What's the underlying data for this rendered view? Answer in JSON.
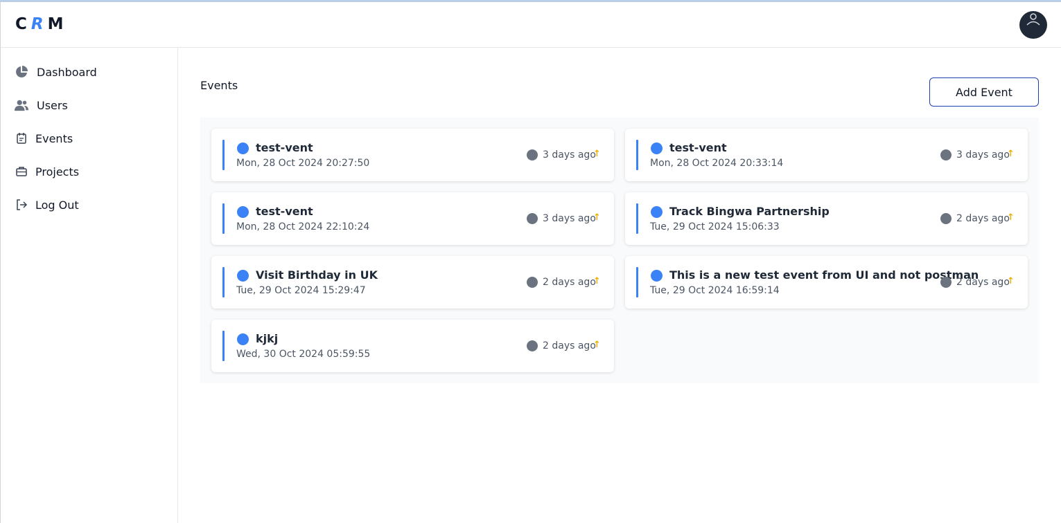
{
  "app": {
    "logo": {
      "c": "C",
      "r": "R",
      "m": "M"
    }
  },
  "sidebar": {
    "items": [
      {
        "label": "Dashboard",
        "icon": "pie-chart-icon"
      },
      {
        "label": "Users",
        "icon": "users-icon"
      },
      {
        "label": "Events",
        "icon": "calendar-icon"
      },
      {
        "label": "Projects",
        "icon": "briefcase-icon"
      },
      {
        "label": "Log Out",
        "icon": "logout-icon"
      }
    ]
  },
  "main": {
    "title": "Events",
    "add_button": "Add Event"
  },
  "events": [
    {
      "title": "test-vent",
      "date": "Mon, 28 Oct 2024 20:27:50",
      "ago": "3 days ago"
    },
    {
      "title": "test-vent",
      "date": "Mon, 28 Oct 2024 20:33:14",
      "ago": "3 days ago"
    },
    {
      "title": "test-vent",
      "date": "Mon, 28 Oct 2024 22:10:24",
      "ago": "3 days ago"
    },
    {
      "title": "Track Bingwa Partnership",
      "date": "Tue, 29 Oct 2024 15:06:33",
      "ago": "2 days ago"
    },
    {
      "title": "Visit Birthday in UK",
      "date": "Tue, 29 Oct 2024 15:29:47",
      "ago": "2 days ago"
    },
    {
      "title": "This is a new test event from UI and not postman",
      "date": "Tue, 29 Oct 2024 16:59:14",
      "ago": "2 days ago"
    },
    {
      "title": "kjkj",
      "date": "Wed, 30 Oct 2024 05:59:55",
      "ago": "2 days ago"
    }
  ],
  "arrow_glyph": "↑",
  "colors": {
    "accent": "#3b82f6",
    "brand_dark": "#1f2937",
    "arrow": "#eab308"
  }
}
